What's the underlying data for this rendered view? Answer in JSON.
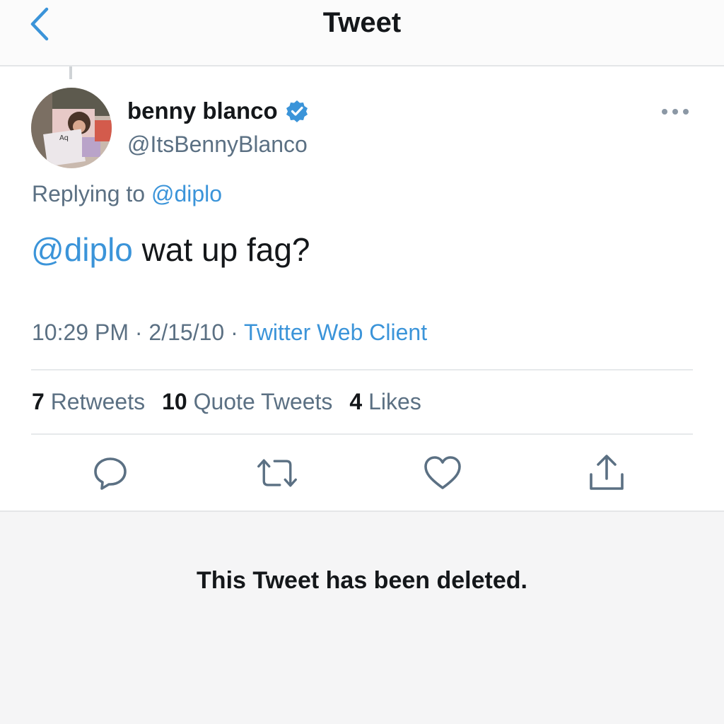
{
  "header": {
    "title": "Tweet",
    "back_icon": "chevron-left-icon"
  },
  "tweet": {
    "author": {
      "display_name": "benny blanco",
      "handle": "@ItsBennyBlanco",
      "verified": true
    },
    "replying_prefix": "Replying to ",
    "replying_to": "@diplo",
    "text_mention": "@diplo",
    "text_body": " wat up fag?",
    "time": "10:29 PM",
    "date": "2/15/10",
    "separator": " · ",
    "client": "Twitter Web Client",
    "stats": {
      "retweets_count": "7",
      "retweets_label": "Retweets",
      "quotes_count": "10",
      "quotes_label": "Quote Tweets",
      "likes_count": "4",
      "likes_label": "Likes"
    },
    "actions": [
      "reply-icon",
      "retweet-icon",
      "like-icon",
      "share-icon"
    ]
  },
  "deleted_notice": "This Tweet has been deleted.",
  "colors": {
    "accent": "#3b94d9",
    "text": "#14171a",
    "secondary": "#5b7083",
    "divider": "#e6e9eb",
    "deleted_bg": "#f5f5f6"
  }
}
